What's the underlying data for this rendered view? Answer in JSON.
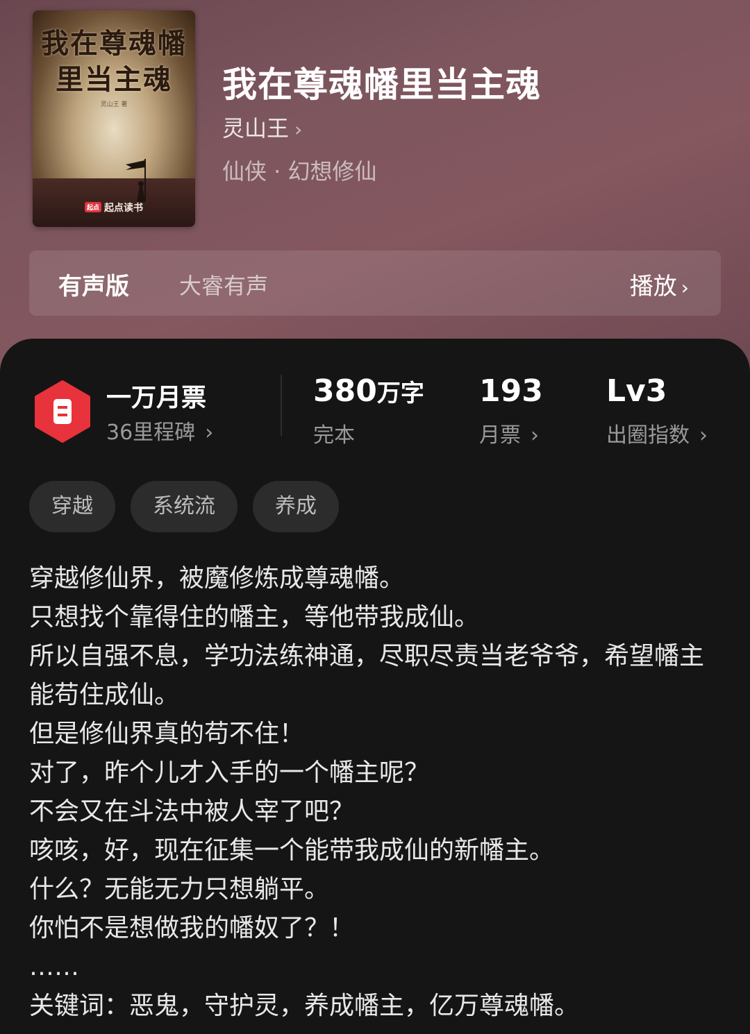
{
  "book": {
    "cover_title": "我在尊魂幡里当主魂",
    "cover_author": "灵山王 著",
    "cover_brand_logo": "起点",
    "cover_brand": "起点读书",
    "title": "我在尊魂幡里当主魂",
    "author": "灵山王",
    "genre": "仙侠 · 幻想修仙"
  },
  "audio": {
    "label": "有声版",
    "narrator": "大睿有声",
    "play_label": "播放"
  },
  "stats": {
    "ticket_title": "一万月票",
    "ticket_sub": "36里程碑",
    "words_value": "380",
    "words_unit": "万字",
    "words_sub": "完本",
    "monthly_value": "193",
    "monthly_sub": "月票",
    "level_value": "Lv3",
    "level_sub": "出圈指数"
  },
  "tags": [
    "穿越",
    "系统流",
    "养成"
  ],
  "description": [
    "穿越修仙界，被魔修炼成尊魂幡。",
    "只想找个靠得住的幡主，等他带我成仙。",
    "所以自强不息，学功法练神通，尽职尽责当老爷爷，希望幡主能苟住成仙。",
    "但是修仙界真的苟不住！",
    "对了，昨个儿才入手的一个幡主呢？",
    "不会又在斗法中被人宰了吧？",
    "咳咳，好，现在征集一个能带我成仙的新幡主。",
    "什么？无能无力只想躺平。",
    "你怕不是想做我的幡奴了？！",
    "……"
  ],
  "keywords": "关键词：恶鬼，守护灵，养成幡主，亿万尊魂幡。",
  "icons": {
    "chevron": "›",
    "ticket_badge": "ticket-icon"
  },
  "colors": {
    "hero_bg": "#7d565e",
    "panel_bg": "#151515",
    "badge_red": "#e8323c",
    "tag_bg": "#2c2c2c"
  }
}
